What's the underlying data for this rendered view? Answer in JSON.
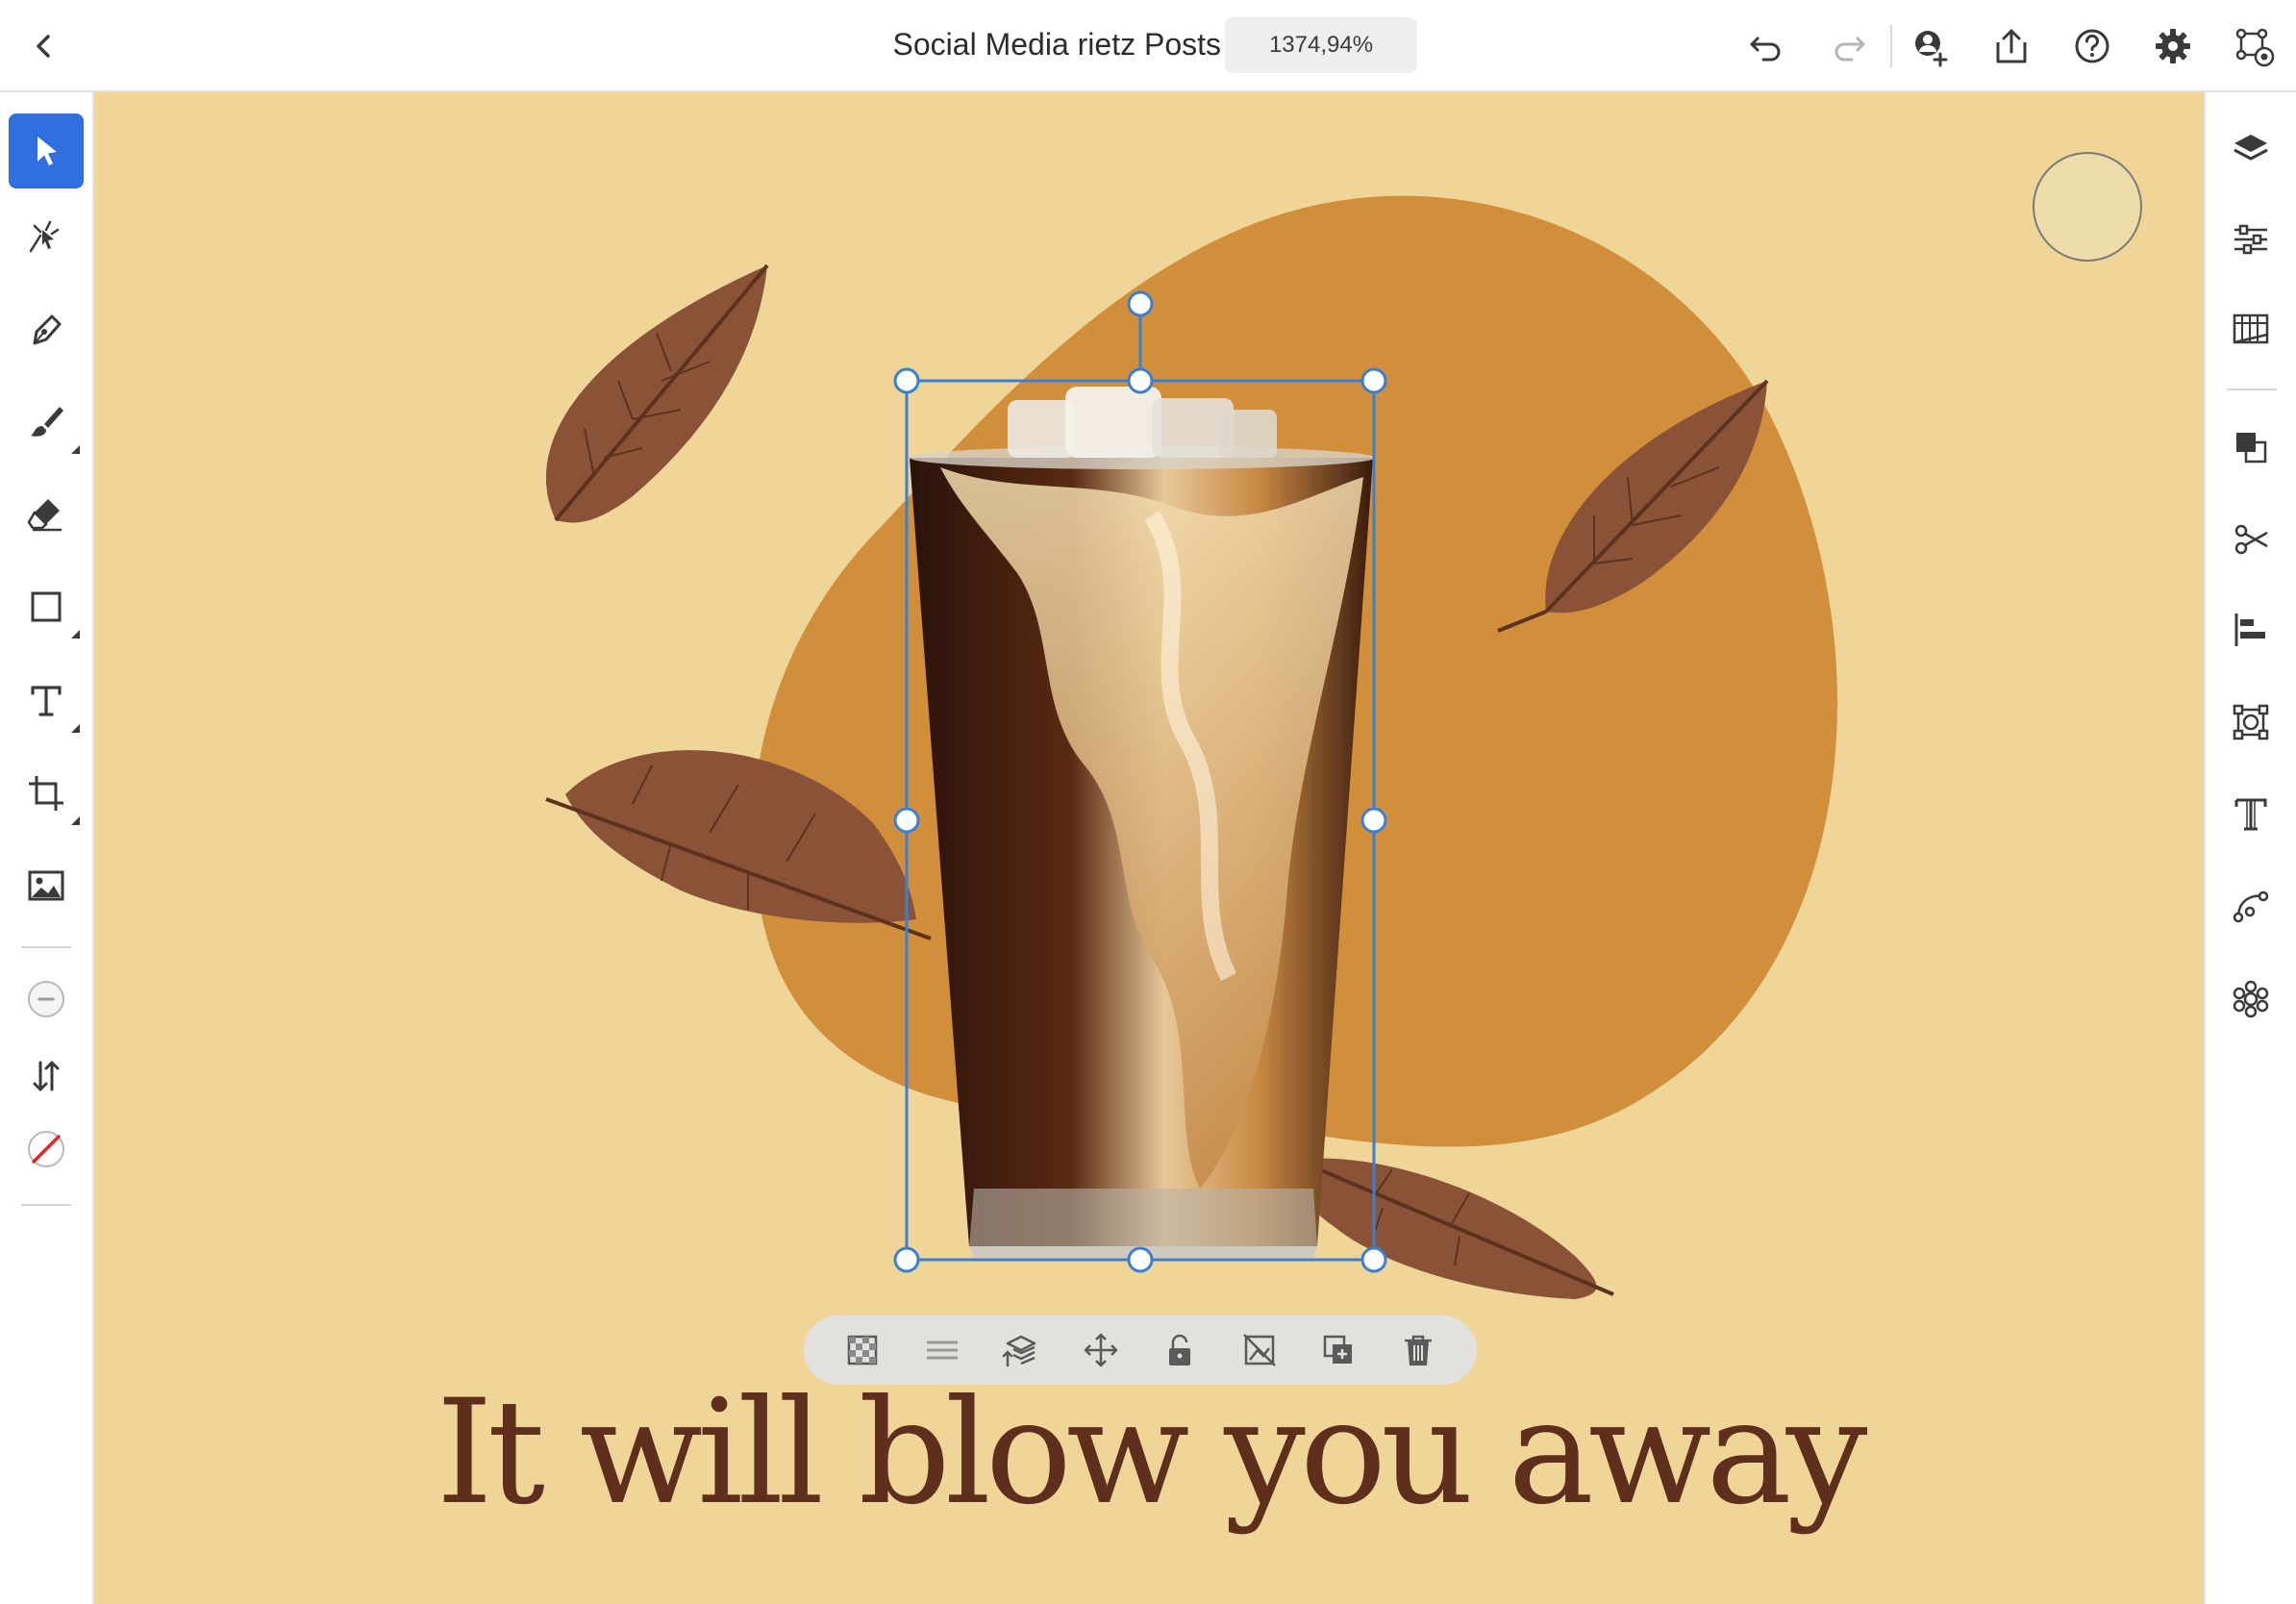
{
  "document": {
    "title": "Social Media rietz Posts",
    "zoom": "1374,94%"
  },
  "topbar": {
    "back_icon": "chevron-left-icon",
    "actions": [
      "undo-icon",
      "redo-icon",
      "invite-icon",
      "share-icon",
      "help-icon",
      "gear-icon",
      "prototype-icon"
    ]
  },
  "left_toolbar": {
    "tools": [
      "selection",
      "direct-selection",
      "pen",
      "brush",
      "eraser",
      "rectangle",
      "type",
      "crop",
      "place-image",
      "fill-none",
      "swap",
      "stroke-none"
    ],
    "active": "selection"
  },
  "right_panel": {
    "panels": [
      "layers",
      "properties",
      "libraries",
      "arrange",
      "cut",
      "align",
      "transform",
      "character",
      "path",
      "repeat"
    ]
  },
  "canvas": {
    "background_color": "#efd598",
    "blob_color": "#d18f3c",
    "headline": "It will blow you away",
    "headline_color": "#5f2e1d",
    "selection_color": "#3b7fd4",
    "swatch_color": "#efdcab"
  },
  "context_toolbar": {
    "actions": [
      "opacity-icon",
      "blend-icon",
      "layer-order-icon",
      "move-icon",
      "unlock-icon",
      "mask-icon",
      "duplicate-icon",
      "delete-icon"
    ]
  }
}
